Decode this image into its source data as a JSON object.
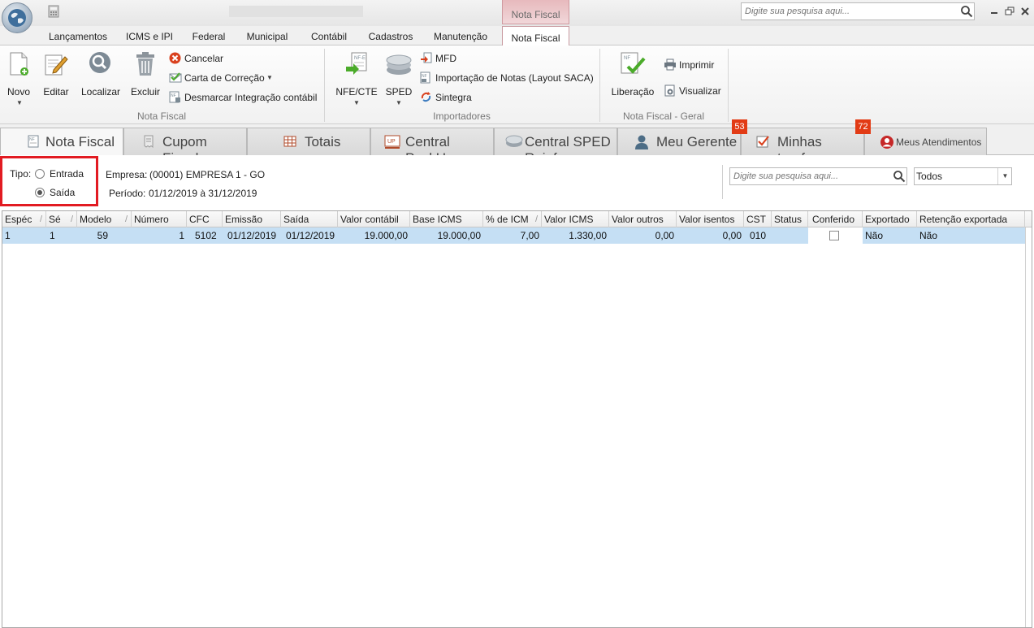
{
  "titlebar": {
    "context_tab_header": "Nota Fiscal",
    "search_placeholder": "Digite sua pesquisa aqui..."
  },
  "ribbon_tabs": [
    "Lançamentos",
    "ICMS e IPI",
    "Federal",
    "Municipal",
    "Contábil",
    "Cadastros",
    "Manutenção",
    "Nota Fiscal"
  ],
  "ribbon": {
    "nota_fiscal_group": {
      "label": "Nota Fiscal",
      "novo": "Novo",
      "editar": "Editar",
      "localizar": "Localizar",
      "excluir": "Excluir",
      "cancelar": "Cancelar",
      "carta_correcao": "Carta de Correção",
      "desmarcar": "Desmarcar Integração contábil"
    },
    "importadores_group": {
      "label": "Importadores",
      "nfe_cte": "NFE/CTE",
      "sped": "SPED",
      "mfd": "MFD",
      "importacao": "Importação de Notas (Layout SACA)",
      "sintegra": "Sintegra"
    },
    "geral_group": {
      "label": "Nota Fiscal - Geral",
      "liberacao": "Liberação",
      "imprimir": "Imprimir",
      "visualizar": "Visualizar"
    }
  },
  "doc_tabs": {
    "nota_fiscal": "Nota Fiscal",
    "cupom_fiscal": "Cupom Fiscal",
    "totais": "Totais",
    "central_packup": "Central PackUp",
    "central_sped_reinf": "Central SPED Reinf",
    "meu_gerente": "Meu Gerente",
    "minhas_tarefas": "Minhas tarefas",
    "minhas_tarefas_badge": "72",
    "meu_gerente_badge": "53",
    "meus_atendimentos": "Meus Atendimentos"
  },
  "filters": {
    "tipo_label": "Tipo:",
    "entrada": "Entrada",
    "saida": "Saída",
    "selected": "Saída",
    "empresa_label": "Empresa:",
    "empresa_value": "(00001) EMPRESA 1 - GO",
    "periodo_label": "Período:",
    "periodo_value": "01/12/2019 à 31/12/2019",
    "search_placeholder": "Digite sua pesquisa aqui...",
    "select_value": "Todos"
  },
  "grid": {
    "columns": [
      "Espéc",
      "Sé",
      "Modelo",
      "Número",
      "CFC",
      "Emissão",
      "Saída",
      "Valor contábil",
      "Base ICMS",
      "% de ICM",
      "Valor ICMS",
      "Valor outros",
      "Valor isentos",
      "CST",
      "Status",
      "Conferido",
      "Exportado",
      "Retenção exportada"
    ],
    "rows": [
      {
        "especie": "1",
        "serie": "1",
        "modelo": "59",
        "numero": "1",
        "cfc": "5102",
        "emissao": "01/12/2019",
        "saida": "01/12/2019",
        "valor_contabil": "19.000,00",
        "base_icms": "19.000,00",
        "pct_icms": "7,00",
        "valor_icms": "1.330,00",
        "valor_outros": "0,00",
        "valor_isentos": "0,00",
        "cst": "010",
        "status": "",
        "conferido": false,
        "exportado": "Não",
        "retencao_exportada": "Não"
      }
    ]
  },
  "colors": {
    "highlight_border": "#e21b22",
    "badge": "#e23b15",
    "selected_row": "#c5dff4",
    "context_tab": "#e7b9bd"
  }
}
